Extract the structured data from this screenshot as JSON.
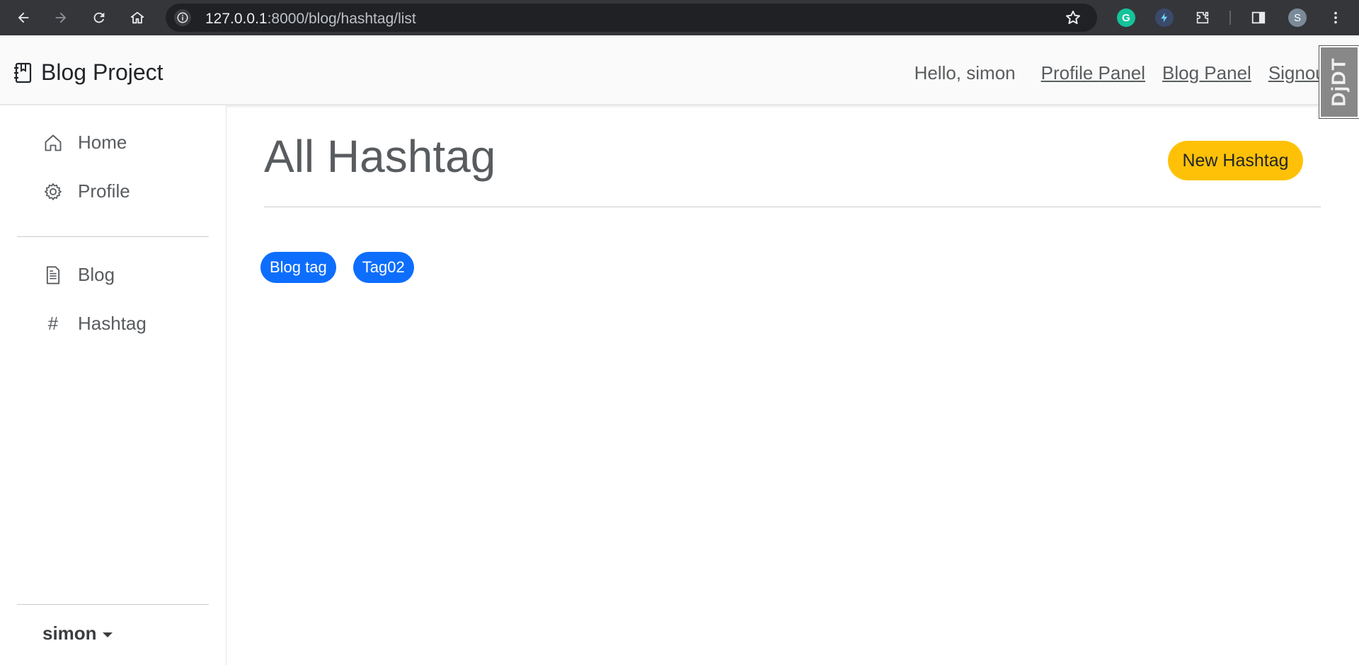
{
  "browser": {
    "url_host": "127.0.0.1",
    "url_path": ":8000/blog/hashtag/list",
    "profile_initial": "S"
  },
  "navbar": {
    "brand": "Blog Project",
    "greeting": "Hello, simon",
    "links": [
      "Profile Panel",
      "Blog Panel",
      "Signout"
    ],
    "debug_toolbar_label": "DjDT"
  },
  "sidebar": {
    "items": [
      {
        "label": "Home",
        "icon": "house-icon"
      },
      {
        "label": "Profile",
        "icon": "gear-icon"
      },
      {
        "label": "Blog",
        "icon": "document-icon"
      },
      {
        "label": "Hashtag",
        "icon": "hash-icon"
      }
    ],
    "user": "simon"
  },
  "main": {
    "title": "All Hashtag",
    "new_button": "New Hashtag",
    "tags": [
      "Blog tag",
      "Tag02"
    ]
  },
  "colors": {
    "accent_yellow": "#ffc107",
    "tag_blue": "#0d6efd",
    "chrome_bg": "#35363a"
  }
}
